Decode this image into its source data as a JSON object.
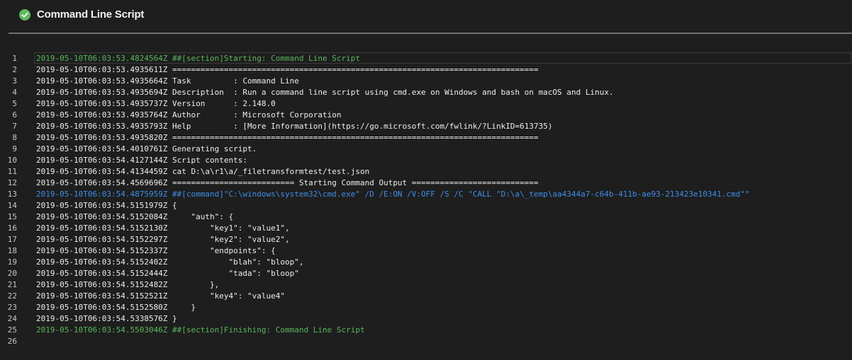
{
  "header": {
    "title": "Command Line Script",
    "status_icon": "check-circle-icon",
    "status_color": "#5fb95f"
  },
  "colors": {
    "background": "#1e1e1e",
    "section": "#58b65a",
    "command": "#3d8ee8",
    "text": "#ededed"
  },
  "log": {
    "lines": [
      {
        "n": "1",
        "text": "2019-05-10T06:03:53.4824564Z ##[section]Starting: Command Line Script",
        "kind": "section"
      },
      {
        "n": "2",
        "text": "2019-05-10T06:03:53.4935611Z ==============================================================================",
        "kind": "normal"
      },
      {
        "n": "3",
        "text": "2019-05-10T06:03:53.4935664Z Task         : Command Line",
        "kind": "normal"
      },
      {
        "n": "4",
        "text": "2019-05-10T06:03:53.4935694Z Description  : Run a command line script using cmd.exe on Windows and bash on macOS and Linux.",
        "kind": "normal"
      },
      {
        "n": "5",
        "text": "2019-05-10T06:03:53.4935737Z Version      : 2.148.0",
        "kind": "normal"
      },
      {
        "n": "6",
        "text": "2019-05-10T06:03:53.4935764Z Author       : Microsoft Corporation",
        "kind": "normal"
      },
      {
        "n": "7",
        "text": "2019-05-10T06:03:53.4935793Z Help         : [More Information](https://go.microsoft.com/fwlink/?LinkID=613735)",
        "kind": "normal"
      },
      {
        "n": "8",
        "text": "2019-05-10T06:03:53.4935820Z ==============================================================================",
        "kind": "normal"
      },
      {
        "n": "9",
        "text": "2019-05-10T06:03:54.4010761Z Generating script.",
        "kind": "normal"
      },
      {
        "n": "10",
        "text": "2019-05-10T06:03:54.4127144Z Script contents:",
        "kind": "normal"
      },
      {
        "n": "11",
        "text": "2019-05-10T06:03:54.4134459Z cat D:\\a\\r1\\a/_filetransformtest/test.json",
        "kind": "normal"
      },
      {
        "n": "12",
        "text": "2019-05-10T06:03:54.4569696Z ========================== Starting Command Output ===========================",
        "kind": "normal"
      },
      {
        "n": "13",
        "text": "2019-05-10T06:03:54.4875959Z ##[command]\"C:\\windows\\system32\\cmd.exe\" /D /E:ON /V:OFF /S /C \"CALL \"D:\\a\\_temp\\aa4344a7-c64b-411b-ae93-213423e10341.cmd\"\"",
        "kind": "command"
      },
      {
        "n": "14",
        "text": "2019-05-10T06:03:54.5151979Z {",
        "kind": "normal"
      },
      {
        "n": "15",
        "text": "2019-05-10T06:03:54.5152084Z     \"auth\": {",
        "kind": "normal"
      },
      {
        "n": "16",
        "text": "2019-05-10T06:03:54.5152130Z         \"key1\": \"value1\",",
        "kind": "normal"
      },
      {
        "n": "17",
        "text": "2019-05-10T06:03:54.5152297Z         \"key2\": \"value2\",",
        "kind": "normal"
      },
      {
        "n": "18",
        "text": "2019-05-10T06:03:54.5152337Z         \"endpoints\": {",
        "kind": "normal"
      },
      {
        "n": "19",
        "text": "2019-05-10T06:03:54.5152402Z             \"blah\": \"bloop\",",
        "kind": "normal"
      },
      {
        "n": "20",
        "text": "2019-05-10T06:03:54.5152444Z             \"tada\": \"bloop\"",
        "kind": "normal"
      },
      {
        "n": "21",
        "text": "2019-05-10T06:03:54.5152482Z         },",
        "kind": "normal"
      },
      {
        "n": "22",
        "text": "2019-05-10T06:03:54.5152521Z         \"key4\": \"value4\"",
        "kind": "normal"
      },
      {
        "n": "23",
        "text": "2019-05-10T06:03:54.5152580Z     }",
        "kind": "normal"
      },
      {
        "n": "24",
        "text": "2019-05-10T06:03:54.5338576Z }",
        "kind": "normal"
      },
      {
        "n": "25",
        "text": "2019-05-10T06:03:54.5503046Z ##[section]Finishing: Command Line Script",
        "kind": "section"
      },
      {
        "n": "26",
        "text": "",
        "kind": "normal"
      }
    ]
  }
}
